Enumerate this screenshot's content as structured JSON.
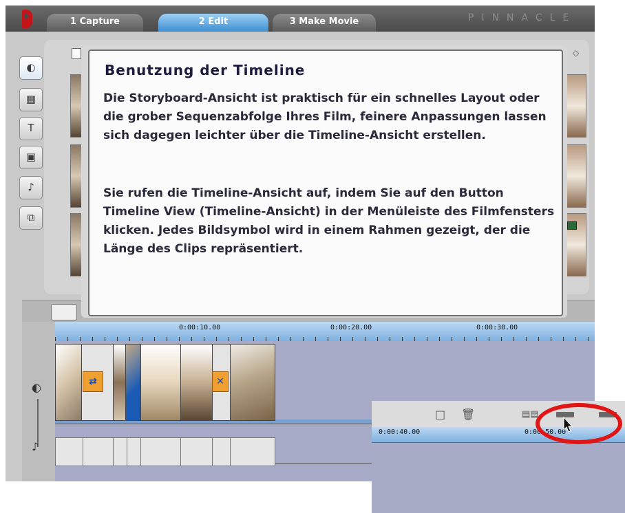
{
  "tabs": [
    {
      "label": "1 Capture",
      "active": false
    },
    {
      "label": "2 Edit",
      "active": true
    },
    {
      "label": "3 Make Movie",
      "active": false
    }
  ],
  "brand": "PINNACLE",
  "tooltip": {
    "title": "Benutzung der Timeline",
    "paragraph1": "Die Storyboard-Ansicht ist praktisch für ein schnelles Layout oder die grober Sequenzabfolge Ihres Film, feinere Anpassungen lassen sich dagegen leichter über die Timeline-Ansicht erstellen.",
    "paragraph2": "Sie rufen die Timeline-Ansicht auf, indem Sie auf den Button Timeline View (Timeline-Ansicht) in der Menüleiste des Filmfensters klicken. Jedes Bildsymbol wird in einem Rahmen gezeigt, der die Länge des Clips repräsentiert."
  },
  "timeline": {
    "ruler_labels": [
      "0:00:10.00",
      "0:00:20.00",
      "0:00:30.00"
    ]
  },
  "inset": {
    "ruler_labels": [
      "0:00:40.00",
      "0:00:50.00"
    ]
  },
  "colors": {
    "active_tab": "#3d8ed2",
    "highlight_circle": "#e01616",
    "ruler": "#9cc4ea",
    "track_background": "#a7abc8",
    "transition": "#f0a030"
  },
  "icons": [
    "pinnacle-logo-icon",
    "camera-icon",
    "film-icon",
    "title-icon",
    "image-icon",
    "sound-icon",
    "audio-icon",
    "toolbox-icon",
    "video-track-icon",
    "audio-track-icon",
    "delete-icon",
    "storyboard-view-icon",
    "timeline-view-icon",
    "text-view-icon",
    "mouse-cursor-icon"
  ]
}
